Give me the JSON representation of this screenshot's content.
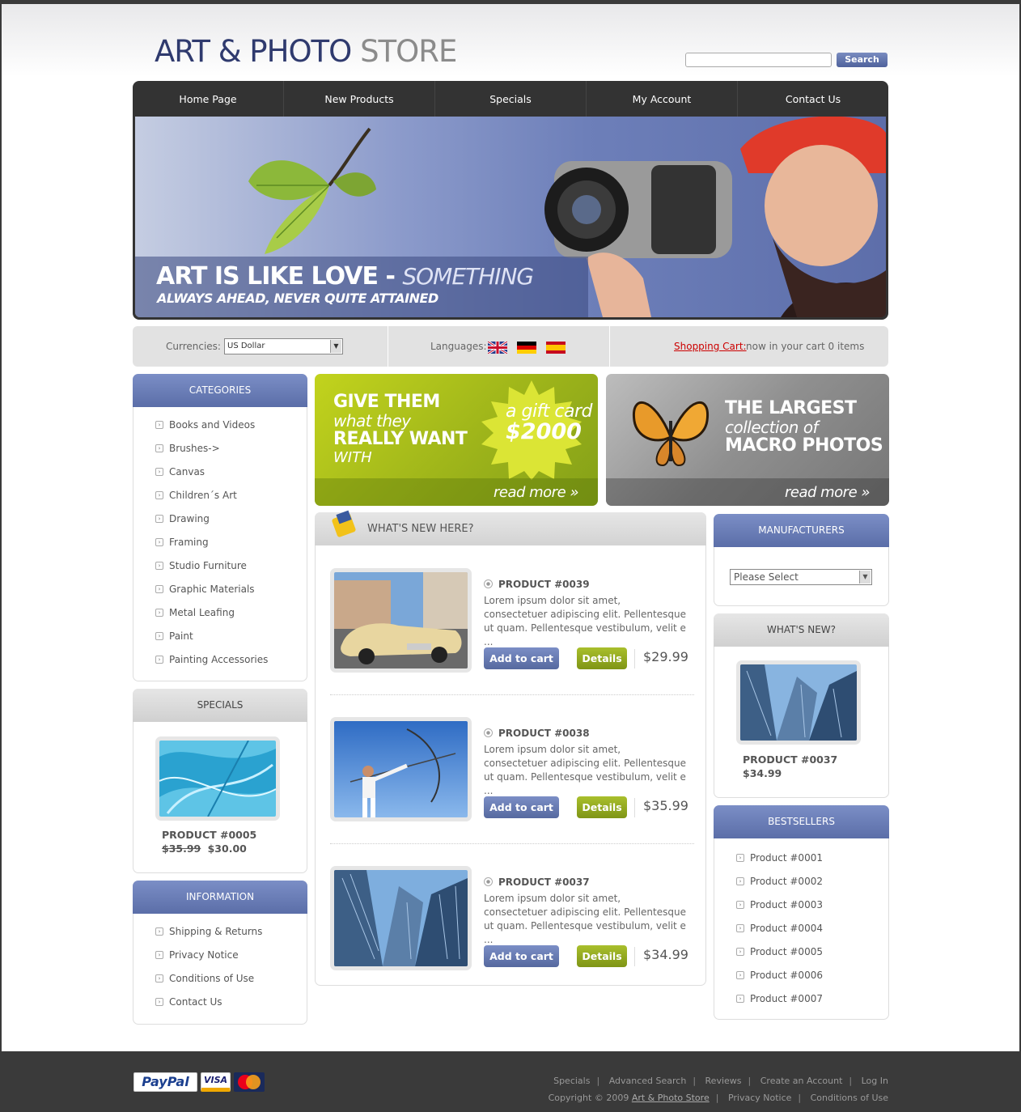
{
  "header": {
    "logo_main": "ART & PHOTO",
    "logo_sub": "STORE",
    "search_button": "Search",
    "search_placeholder": ""
  },
  "nav": {
    "items": [
      "Home Page",
      "New Products",
      "Specials",
      "My Account",
      "Contact Us"
    ]
  },
  "banner": {
    "title_bold": "ART IS LIKE LOVE -",
    "title_thin": "SOMETHING",
    "subtitle": "ALWAYS AHEAD, NEVER QUITE ATTAINED"
  },
  "toolbar": {
    "currencies_label": "Currencies:",
    "currency_value": "US Dollar",
    "languages_label": "Languages:",
    "cart_link": "Shopping Cart:",
    "cart_text": "now in your cart 0 items"
  },
  "categories": {
    "title": "CATEGORIES",
    "items": [
      "Books and Videos",
      "Brushes->",
      "Canvas",
      "Children´s Art",
      "Drawing",
      "Framing",
      "Studio Furniture",
      "Graphic Materials",
      "Metal Leafing",
      "Paint",
      "Painting Accessories"
    ]
  },
  "specials": {
    "title": "SPECIALS",
    "product_name": "PRODUCT #0005",
    "old_price": "$35.99",
    "new_price": "$30.00"
  },
  "information": {
    "title": "INFORMATION",
    "items": [
      "Shipping & Returns",
      "Privacy Notice",
      "Conditions of Use",
      "Contact Us"
    ]
  },
  "promo_gift": {
    "line1": "GIVE THEM",
    "line2": "what they",
    "line3": "REALLY WANT",
    "line4": "WITH",
    "gift_text": "a gift card",
    "gift_value": "$2000",
    "read_more": "read more »"
  },
  "promo_macro": {
    "line1": "THE LARGEST",
    "line2": "collection of",
    "line3": "MACRO PHOTOS",
    "read_more": "read more »"
  },
  "whats_new_main": {
    "title": "WHAT'S NEW HERE?",
    "products": [
      {
        "name": "PRODUCT #0039",
        "desc": "Lorem ipsum dolor sit amet, consectetuer adipiscing elit. Pellentesque ut quam. Pellentesque vestibulum, velit e ...",
        "add": "Add to cart",
        "details": "Details",
        "price": "$29.99"
      },
      {
        "name": "PRODUCT #0038",
        "desc": "Lorem ipsum dolor sit amet, consectetuer adipiscing elit. Pellentesque ut quam. Pellentesque vestibulum, velit e ...",
        "add": "Add to cart",
        "details": "Details",
        "price": "$35.99"
      },
      {
        "name": "PRODUCT #0037",
        "desc": "Lorem ipsum dolor sit amet, consectetuer adipiscing elit. Pellentesque ut quam. Pellentesque vestibulum, velit e ...",
        "add": "Add to cart",
        "details": "Details",
        "price": "$34.99"
      }
    ]
  },
  "manufacturers": {
    "title": "MANUFACTURERS",
    "select_value": "Please Select"
  },
  "whats_new_side": {
    "title": "WHAT'S NEW?",
    "product_name": "PRODUCT #0037",
    "price": "$34.99"
  },
  "bestsellers": {
    "title": "BESTSELLERS",
    "items": [
      "Product #0001",
      "Product #0002",
      "Product #0003",
      "Product #0004",
      "Product #0005",
      "Product #0006",
      "Product #0007"
    ]
  },
  "footer": {
    "links": [
      "Specials",
      "Advanced Search",
      "Reviews",
      "Create an Account",
      "Log In"
    ],
    "copyright_prefix": "Copyright © 2009",
    "copyright_store": "Art & Photo Store",
    "bottom_links": [
      "Privacy Notice",
      "Conditions of Use"
    ],
    "payment": [
      "PayPal",
      "VISA",
      "MasterCard"
    ]
  },
  "colors": {
    "brand_blue": "#5b6ea8",
    "accent_green": "#8fa51c",
    "link_red": "#cc0000"
  }
}
